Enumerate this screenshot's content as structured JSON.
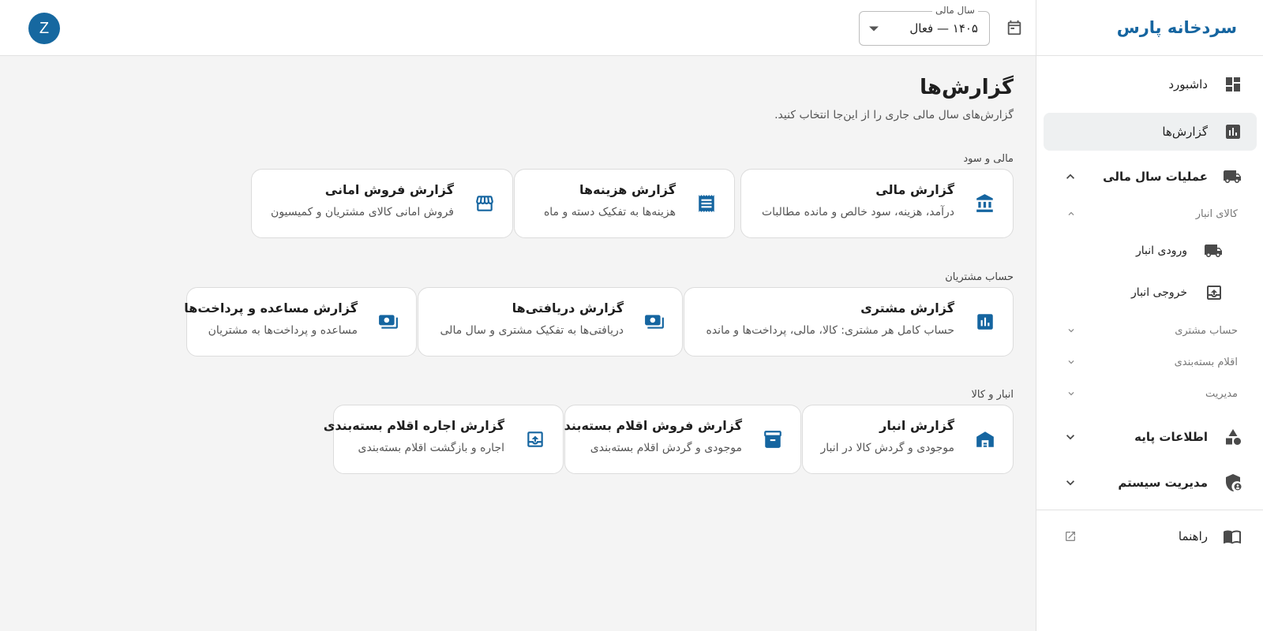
{
  "app": {
    "brand": "سردخانه پارس"
  },
  "topbar": {
    "fiscal_year_label": "سال مالی",
    "fiscal_year_value": "۱۴۰۵ — فعال",
    "avatar_letter": "Z"
  },
  "sidebar": {
    "items": [
      {
        "label": "داشبورد",
        "icon": "dashboard-icon"
      },
      {
        "label": "گزارش‌ها",
        "icon": "bar-chart-icon",
        "active": true
      },
      {
        "label": "عملیات سال مالی",
        "icon": "truck-icon",
        "expanded": true
      }
    ],
    "fiscal_ops": {
      "groups": [
        {
          "label": "کالای انبار",
          "expanded": true
        },
        {
          "label": "حساب مشتری",
          "expanded": false
        },
        {
          "label": "اقلام بسته‌بندی",
          "expanded": false
        },
        {
          "label": "مدیریت",
          "expanded": false
        }
      ],
      "warehouse_items": [
        {
          "label": "ورودی انبار",
          "icon": "truck-icon"
        },
        {
          "label": "خروجی انبار",
          "icon": "box-out-icon"
        }
      ]
    },
    "bottom_items": [
      {
        "label": "اطلاعات پایه",
        "icon": "shapes-icon"
      },
      {
        "label": "مدیریت سیستم",
        "icon": "shield-user-icon"
      }
    ],
    "help": {
      "label": "راهنما",
      "icon": "book-icon"
    }
  },
  "main": {
    "title": "گزارش‌ها",
    "subtitle": "گزارش‌های سال مالی جاری را از این‌جا انتخاب کنید.",
    "sections": [
      {
        "label": "مالی و سود",
        "cards": [
          {
            "title": "گزارش مالی",
            "desc": "درآمد، هزینه، سود خالص و مانده مطالبات",
            "icon": "bank-icon"
          },
          {
            "title": "گزارش هزینه‌ها",
            "desc": "هزینه‌ها به تفکیک دسته و ماه",
            "icon": "receipt-icon"
          },
          {
            "title": "گزارش فروش امانی",
            "desc": "فروش امانی کالای مشتریان و کمیسیون",
            "icon": "store-icon"
          }
        ]
      },
      {
        "label": "حساب مشتریان",
        "cards": [
          {
            "title": "گزارش مشتری",
            "desc": "حساب کامل هر مشتری: کالا، مالی، پرداخت‌ها و مانده",
            "icon": "bar-chart-icon"
          },
          {
            "title": "گزارش دریافتی‌ها",
            "desc": "دریافتی‌ها به تفکیک مشتری و سال مالی",
            "icon": "payments-icon"
          },
          {
            "title": "گزارش مساعده و پرداخت‌ها",
            "desc": "مساعده و پرداخت‌ها به مشتریان",
            "icon": "payments-icon"
          }
        ]
      },
      {
        "label": "انبار و کالا",
        "cards": [
          {
            "title": "گزارش انبار",
            "desc": "موجودی و گردش کالا در انبار",
            "icon": "warehouse-icon"
          },
          {
            "title": "گزارش فروش اقلام بسته‌بندی",
            "desc": "موجودی و گردش اقلام بسته‌بندی",
            "icon": "archive-icon"
          },
          {
            "title": "گزارش اجاره اقلام بسته‌بندی",
            "desc": "اجاره و بازگشت اقلام بسته‌بندی",
            "icon": "box-out-icon"
          }
        ]
      }
    ]
  },
  "colors": {
    "accent": "#1565a0",
    "active_bg": "#eef0f1",
    "background": "#f4f4f4"
  }
}
